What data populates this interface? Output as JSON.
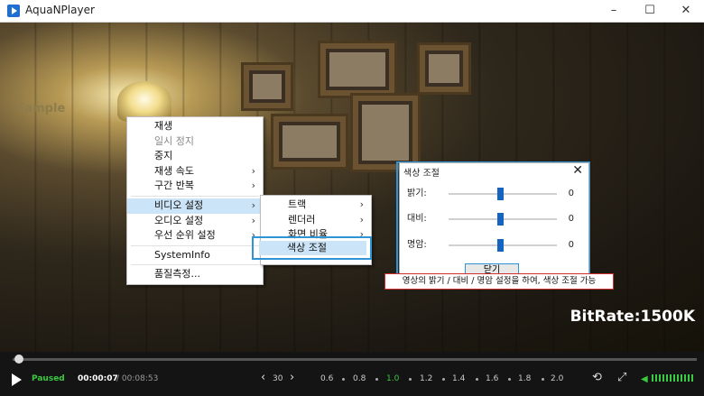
{
  "window": {
    "title": "AquaNPlayer",
    "minimize": "–",
    "maximize": "☐",
    "close": "✕"
  },
  "video": {
    "watermark": "Sample",
    "bitrate": "BitRate:1500K"
  },
  "context_menu": {
    "items": [
      {
        "label": "재생",
        "enabled": true,
        "submenu": false
      },
      {
        "label": "일시 정지",
        "enabled": false,
        "submenu": false
      },
      {
        "label": "중지",
        "enabled": true,
        "submenu": false
      },
      {
        "label": "재생 속도",
        "enabled": true,
        "submenu": true
      },
      {
        "label": "구간 반복",
        "enabled": true,
        "submenu": true
      },
      {
        "label": "비디오 설정",
        "enabled": true,
        "submenu": true,
        "active": true
      },
      {
        "label": "오디오 설정",
        "enabled": true,
        "submenu": true
      },
      {
        "label": "우선 순위 설정",
        "enabled": true,
        "submenu": true
      },
      {
        "label": "SystemInfo",
        "enabled": true,
        "submenu": false
      },
      {
        "label": "품질측정...",
        "enabled": true,
        "submenu": false
      }
    ],
    "arrow": "›"
  },
  "video_submenu": {
    "items": [
      {
        "label": "트랙",
        "submenu": true
      },
      {
        "label": "렌더러",
        "submenu": true
      },
      {
        "label": "화면 비율",
        "submenu": true
      },
      {
        "label": "색상 조절",
        "submenu": false,
        "highlighted": true
      }
    ]
  },
  "color_dialog": {
    "title": "색상 조절",
    "close": "✕",
    "sliders": [
      {
        "label": "밝기:",
        "value": "0",
        "level": 0.5
      },
      {
        "label": "대비:",
        "value": "0",
        "level": 0.5
      },
      {
        "label": "명암:",
        "value": "0",
        "level": 0.5
      }
    ],
    "close_button": "닫기"
  },
  "tooltip": "영상의 밝기 / 대비 / 명암 설정을 하여, 색상 조절 가능",
  "controls": {
    "status": "Paused",
    "current_time": "00:00:07",
    "total_time": "/ 00:08:53",
    "skip_prev": "‹",
    "skip_value": "30",
    "skip_next": "›",
    "speeds": [
      "0.6",
      "0.8",
      "1.0",
      "1.2",
      "1.4",
      "1.6",
      "1.8",
      "2.0"
    ],
    "selected_speed": "1.0",
    "repeat_icon": "⟲",
    "fullscreen_icon": "⤢",
    "volume_icon": "◀",
    "accent": "#3cc840",
    "seek_progress": 0.013
  }
}
